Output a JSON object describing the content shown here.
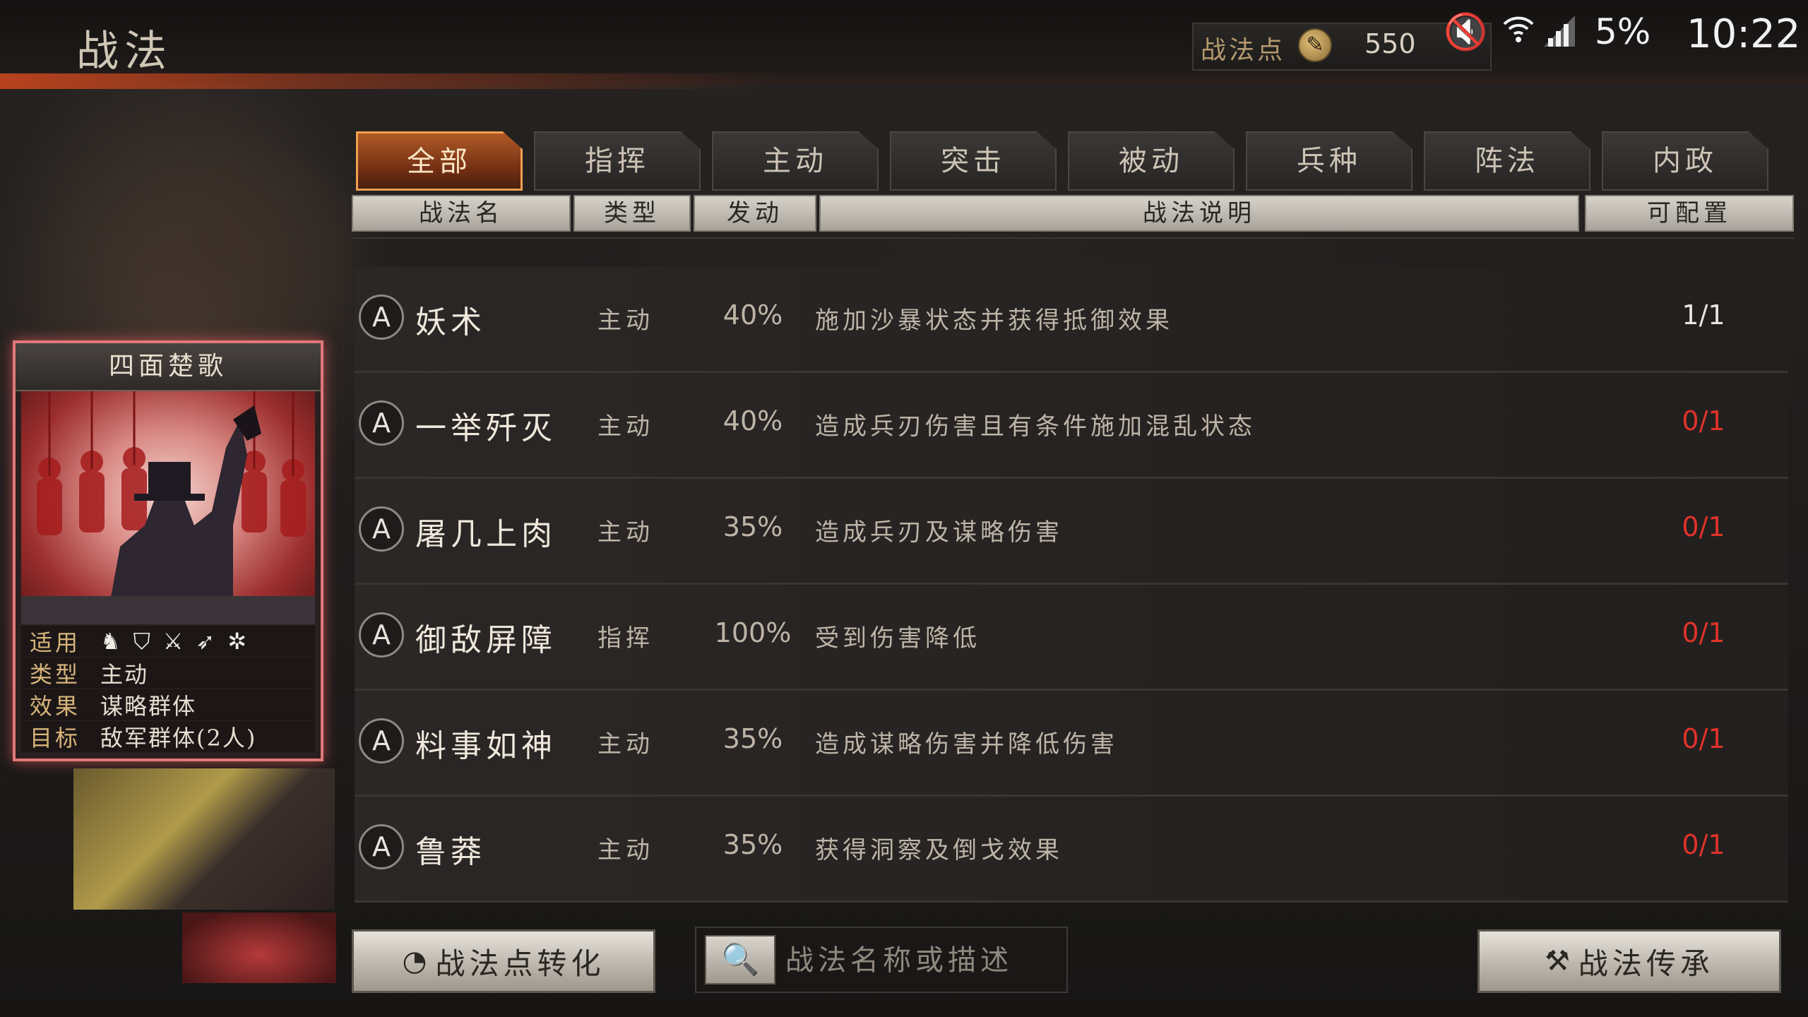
{
  "header": {
    "title": "战法",
    "points_label": "战法点",
    "points_value": "550"
  },
  "status_bar": {
    "battery": "5%",
    "time": "10:22"
  },
  "tabs": [
    {
      "label": "全部",
      "active": true
    },
    {
      "label": "指挥",
      "active": false
    },
    {
      "label": "主动",
      "active": false
    },
    {
      "label": "突击",
      "active": false
    },
    {
      "label": "被动",
      "active": false
    },
    {
      "label": "兵种",
      "active": false
    },
    {
      "label": "阵法",
      "active": false
    },
    {
      "label": "内政",
      "active": false
    }
  ],
  "columns": {
    "name": "战法名",
    "type": "类型",
    "rate": "发动",
    "desc": "战法说明",
    "slots": "可配置"
  },
  "rows": [
    {
      "grade": "A",
      "name": "妖术",
      "type": "主动",
      "rate": "40%",
      "desc": "施加沙暴状态并获得抵御效果",
      "slots": "1/1"
    },
    {
      "grade": "A",
      "name": "一举歼灭",
      "type": "主动",
      "rate": "40%",
      "desc": "造成兵刃伤害且有条件施加混乱状态",
      "slots": "0/1"
    },
    {
      "grade": "A",
      "name": "屠几上肉",
      "type": "主动",
      "rate": "35%",
      "desc": "造成兵刃及谋略伤害",
      "slots": "0/1"
    },
    {
      "grade": "A",
      "name": "御敌屏障",
      "type": "指挥",
      "rate": "100%",
      "desc": "受到伤害降低",
      "slots": "0/1"
    },
    {
      "grade": "A",
      "name": "料事如神",
      "type": "主动",
      "rate": "35%",
      "desc": "造成谋略伤害并降低伤害",
      "slots": "0/1"
    },
    {
      "grade": "A",
      "name": "鲁莽",
      "type": "主动",
      "rate": "35%",
      "desc": "获得洞察及倒戈效果",
      "slots": "0/1"
    }
  ],
  "card": {
    "title": "四面楚歌",
    "apply_label": "适用",
    "type_label": "类型",
    "type_value": "主动",
    "effect_label": "效果",
    "effect_value": "谋略群体",
    "target_label": "目标",
    "target_value": "敌军群体(2人)",
    "troop_icons": [
      "cavalry-icon",
      "shield-icon",
      "crossed-spears-icon",
      "archer-icon",
      "siege-wheel-icon"
    ]
  },
  "buttons": {
    "convert": "战法点转化",
    "inherit": "战法传承"
  },
  "search": {
    "placeholder": "战法名称或描述"
  },
  "colors": {
    "active_tab": "#b15a26",
    "unavailable_slots": "#e0322a",
    "card_border": "#e0787a"
  }
}
